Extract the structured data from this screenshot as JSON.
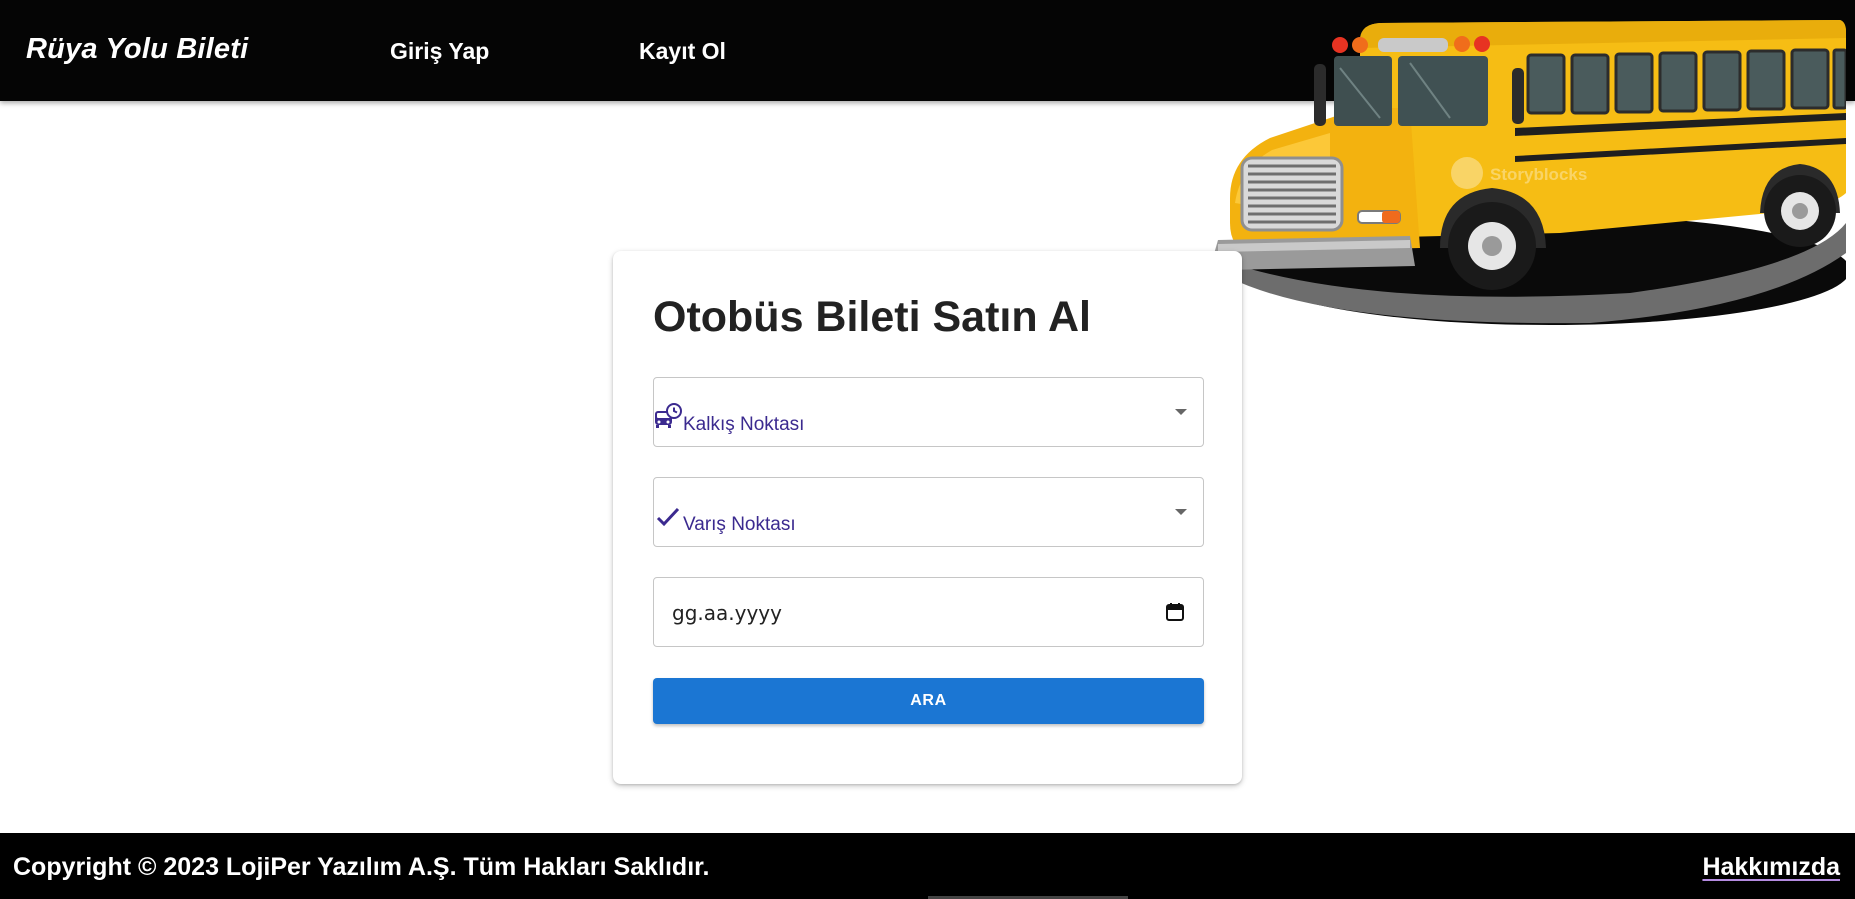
{
  "header": {
    "brand": "Rüya Yolu Bileti",
    "nav": {
      "login_label": "Giriş Yap",
      "register_label": "Kayıt Ol"
    }
  },
  "hero_image": {
    "description_icon": "school-bus-illustration",
    "watermark": "Storyblocks"
  },
  "search_card": {
    "title": "Otobüs Bileti Satın Al",
    "departure": {
      "label": "Kalkış Noktası",
      "icon": "bus-clock-icon"
    },
    "arrival": {
      "label": "Varış Noktası",
      "icon": "check-icon"
    },
    "date": {
      "placeholder": "gg.aa.yyyy",
      "icon": "calendar-icon"
    },
    "search_label": "ARA",
    "accent_color": "#1b76d3",
    "label_color": "#3b2a8f"
  },
  "footer": {
    "copyright": "Copyright © 2023 LojiPer Yazılım A.Ş. Tüm Hakları Saklıdır.",
    "about_label": "Hakkımızda"
  }
}
